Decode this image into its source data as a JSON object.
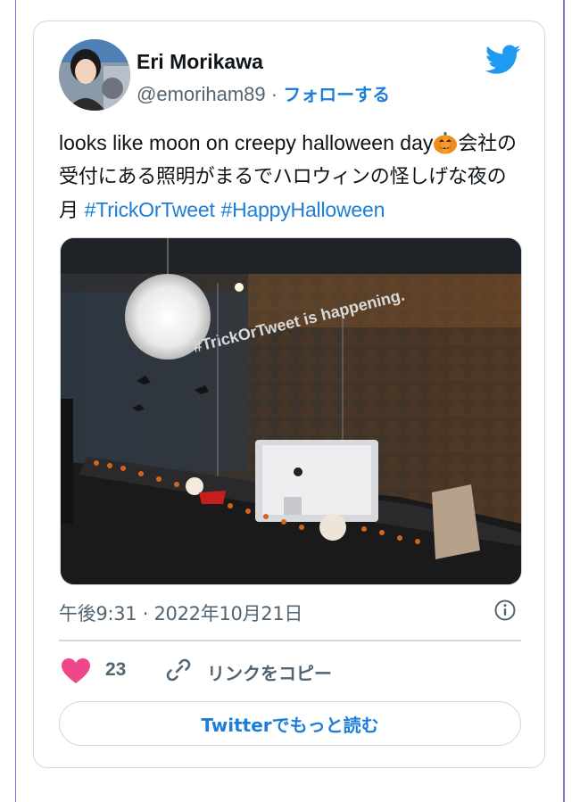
{
  "tweet": {
    "author_name": "Eri Morikawa",
    "handle": "@emoriham89",
    "separator": " · ",
    "follow_label": "フォローする",
    "text_en": "looks like moon on creepy halloween day",
    "text_ja": "会社の受付にある照明がまるでハロウィンの怪しげな夜の月",
    "hashtags": [
      "#TrickOrTweet",
      "#HappyHalloween"
    ],
    "image_wall_text": "#TrickOrTweet is happening.",
    "time": "午後9:31",
    "date": "2022年10月21日",
    "meta_separator": " · ",
    "like_count": "23",
    "copy_link_label": "リンクをコピー",
    "read_more_label": "Twitterでもっと読む"
  },
  "colors": {
    "link": "#1d7ed8",
    "like": "#f0468a",
    "twitter_bird": "#1d9bf0",
    "frame": "#7b78d8"
  },
  "icons": [
    "twitter-bird-icon",
    "pumpkin-emoji-icon",
    "info-icon",
    "heart-icon",
    "link-icon"
  ]
}
